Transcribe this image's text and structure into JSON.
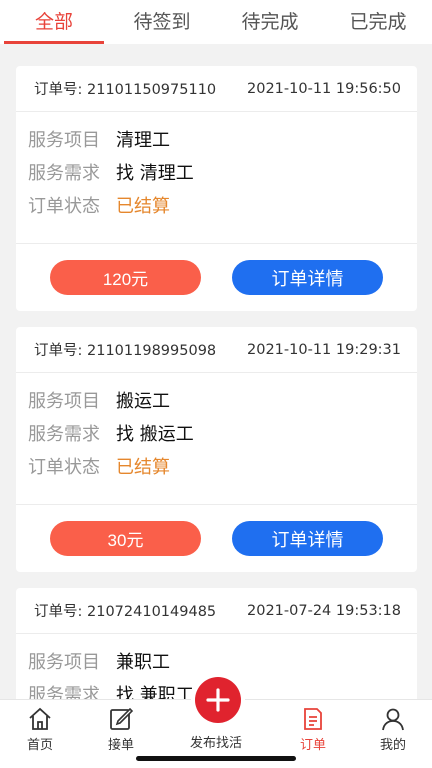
{
  "tabs": [
    {
      "label": "全部"
    },
    {
      "label": "待签到"
    },
    {
      "label": "待完成"
    },
    {
      "label": "已完成"
    }
  ],
  "orders": [
    {
      "no_label": "订单号:",
      "no": "21101150975110",
      "time": "2021-10-11 19:56:50",
      "item_key": "服务项目",
      "item": "清理工",
      "need_key": "服务需求",
      "need": "找 清理工",
      "status_key": "订单状态",
      "status": "已结算",
      "price": "120元",
      "detail": "订单详情"
    },
    {
      "no_label": "订单号:",
      "no": "21101198995098",
      "time": "2021-10-11 19:29:31",
      "item_key": "服务项目",
      "item": "搬运工",
      "need_key": "服务需求",
      "need": "找 搬运工",
      "status_key": "订单状态",
      "status": "已结算",
      "price": "30元",
      "detail": "订单详情"
    },
    {
      "no_label": "订单号:",
      "no": "21072410149485",
      "time": "2021-07-24 19:53:18",
      "item_key": "服务项目",
      "item": "兼职工",
      "need_key": "服务需求",
      "need": "找 兼职工"
    }
  ],
  "nav": [
    {
      "label": "首页",
      "icon": "home-icon"
    },
    {
      "label": "接单",
      "icon": "edit-icon"
    },
    {
      "label": "发布找活",
      "icon": "plus-icon"
    },
    {
      "label": "订单",
      "icon": "order-icon"
    },
    {
      "label": "我的",
      "icon": "user-icon"
    }
  ],
  "colors": {
    "accent": "#e8433a",
    "price": "#fa5f4a",
    "detail": "#1f6ff0",
    "settled": "#e5872d"
  }
}
